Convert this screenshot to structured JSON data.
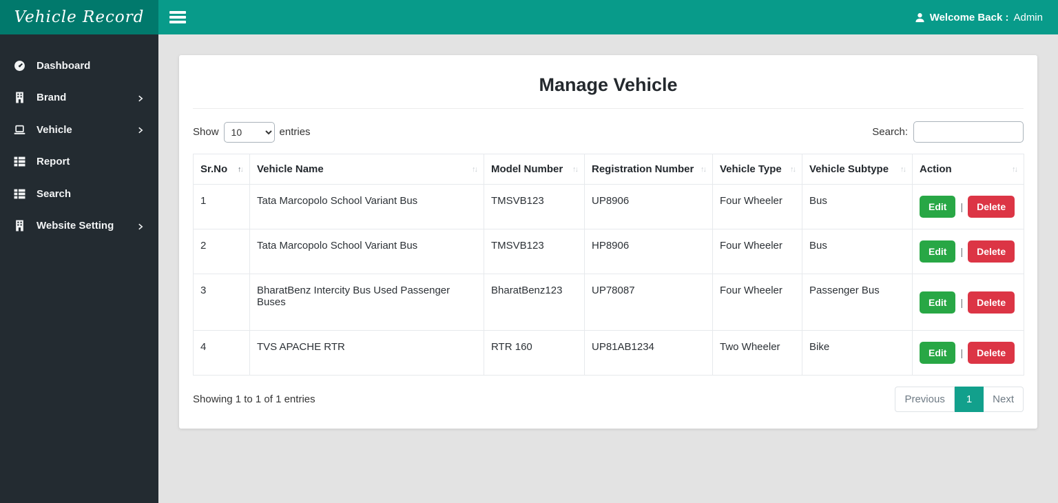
{
  "header": {
    "brand": "Vehicle Record",
    "welcome_bold": "Welcome Back :",
    "welcome_user": "Admin"
  },
  "sidebar": {
    "items": [
      {
        "label": "Dashboard"
      },
      {
        "label": "Brand"
      },
      {
        "label": "Vehicle"
      },
      {
        "label": "Report"
      },
      {
        "label": "Search"
      },
      {
        "label": "Website Setting"
      }
    ]
  },
  "main": {
    "title": "Manage Vehicle",
    "show_label": "Show",
    "entries_label": "entries",
    "page_length": "10",
    "search_label": "Search:",
    "table": {
      "columns": {
        "sr": "Sr.No",
        "name": "Vehicle Name",
        "model": "Model Number",
        "reg": "Registration Number",
        "type": "Vehicle Type",
        "subtype": "Vehicle Subtype",
        "action": "Action"
      },
      "rows": [
        {
          "sr": "1",
          "name": "Tata Marcopolo School Variant Bus",
          "model": "TMSVB123",
          "reg": "UP8906",
          "type": "Four Wheeler",
          "subtype": "Bus"
        },
        {
          "sr": "2",
          "name": "Tata Marcopolo School Variant Bus",
          "model": "TMSVB123",
          "reg": "HP8906",
          "type": "Four Wheeler",
          "subtype": "Bus"
        },
        {
          "sr": "3",
          "name": "BharatBenz Intercity Bus Used Passenger Buses",
          "model": "BharatBenz123",
          "reg": "UP78087",
          "type": "Four Wheeler",
          "subtype": "Passenger Bus"
        },
        {
          "sr": "4",
          "name": "TVS APACHE RTR",
          "model": "RTR 160",
          "reg": "UP81AB1234",
          "type": "Two Wheeler",
          "subtype": "Bike"
        }
      ],
      "edit_label": "Edit",
      "delete_label": "Delete",
      "separator": "|"
    },
    "footer": {
      "info": "Showing 1 to 1 of 1 entries",
      "previous_label": "Previous",
      "page": "1",
      "next_label": "Next"
    }
  },
  "colors": {
    "brand_bg": "#01796c",
    "header_bg": "#089b8a",
    "sidebar_bg": "#232b31",
    "edit_green": "#28a745",
    "delete_red": "#dc3545",
    "active_page_teal": "#12a08c",
    "page_bg": "#e3e3e3"
  }
}
